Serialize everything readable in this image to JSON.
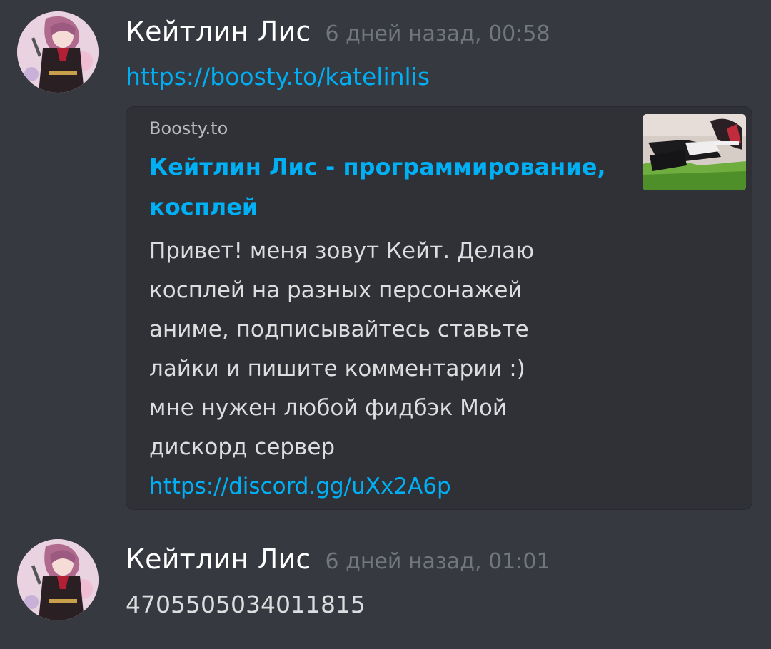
{
  "messages": [
    {
      "author": "Кейтлин Лис",
      "timestamp": "6 дней назад, 00:58",
      "link": "https://boosty.to/katelinlis",
      "embed": {
        "provider": "Boosty.to",
        "title": "Кейтлин Лис - программирование, косплей",
        "description": "Привет! меня зовут Кейт.  Делаю\nкосплей на разных персонажей\nаниме, подписывайтесь ставьте\nлайки и пишите комментарии :)\nмне нужен любой фидбэк  Мой\nдискорд сервер",
        "description_link": "https://discord.gg/uXx2A6p"
      }
    },
    {
      "author": "Кейтлин Лис",
      "timestamp": "6 дней назад, 01:01",
      "text": "470550503401181​5"
    }
  ]
}
